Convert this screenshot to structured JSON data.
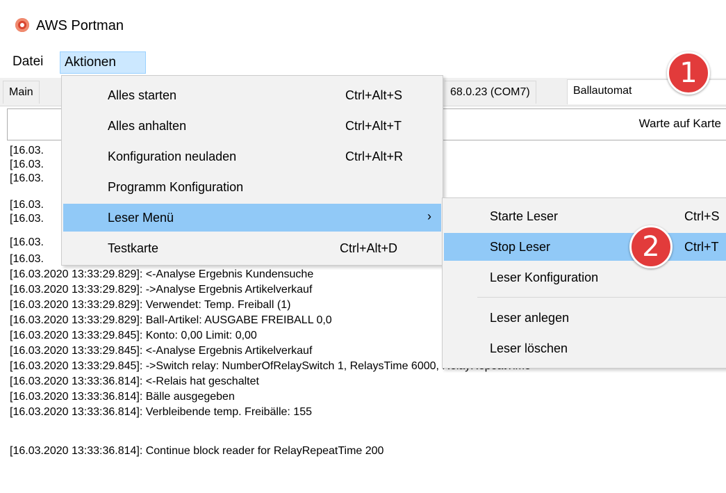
{
  "window": {
    "title": "AWS Portman"
  },
  "menubar": {
    "items": [
      "Datei",
      "Aktionen"
    ]
  },
  "tabs": {
    "main": "Main",
    "device": "68.0.23 (COM7)",
    "ballautomat": "Ballautomat"
  },
  "status": {
    "text": "Warte auf Karte"
  },
  "log": {
    "lines": [
      "[16.03.",
      "[16.03.",
      "[16.03.",
      "[16.03.",
      "[16.03.",
      "[16.03.",
      "[16.03.",
      "[16.03.2020 13:33:29.829]: <-Analyse Ergebnis Kundensuche",
      "[16.03.2020 13:33:29.829]: ->Analyse Ergebnis Artikelverkauf",
      "[16.03.2020 13:33:29.829]: Verwendet: Temp. Freiball (1)",
      "[16.03.2020 13:33:29.829]: Ball-Artikel: AUSGABE FREIBALL 0,0",
      "[16.03.2020 13:33:29.845]: Konto: 0,00 Limit: 0,00",
      "[16.03.2020 13:33:29.845]: <-Analyse Ergebnis Artikelverkauf",
      "[16.03.2020 13:33:29.845]: ->Switch relay: NumberOfRelaySwitch 1, RelaysTime 6000, RelayRepeatTime",
      "[16.03.2020 13:33:36.814]: <-Relais hat geschaltet",
      "[16.03.2020 13:33:36.814]: Bälle ausgegeben",
      "[16.03.2020 13:33:36.814]: Verbleibende temp. Freibälle: 155",
      "[16.03.2020 13:33:36.814]: Continue block reader for RelayRepeatTime 200"
    ]
  },
  "aktionen_menu": {
    "items": [
      {
        "label": "Alles starten",
        "shortcut": "Ctrl+Alt+S"
      },
      {
        "label": "Alles anhalten",
        "shortcut": "Ctrl+Alt+T"
      },
      {
        "label": "Konfiguration neuladen",
        "shortcut": "Ctrl+Alt+R"
      },
      {
        "label": "Programm Konfiguration",
        "shortcut": ""
      },
      {
        "label": "Leser Menü",
        "shortcut": "",
        "submenu_arrow": "›"
      },
      {
        "label": "Testkarte",
        "shortcut": "Ctrl+Alt+D"
      }
    ]
  },
  "leser_menu": {
    "items": [
      {
        "label": "Starte Leser",
        "shortcut": "Ctrl+S"
      },
      {
        "label": "Stop Leser",
        "shortcut": "Ctrl+T"
      },
      {
        "label": "Leser Konfiguration",
        "shortcut": ""
      },
      {
        "label": "Leser anlegen",
        "shortcut": ""
      },
      {
        "label": "Leser löschen",
        "shortcut": ""
      }
    ]
  },
  "badges": [
    "1",
    "2"
  ],
  "colors": {
    "menu_highlight": "#91c9f7",
    "badge": "#e23b3b",
    "menubar_active": "#cce8ff"
  }
}
